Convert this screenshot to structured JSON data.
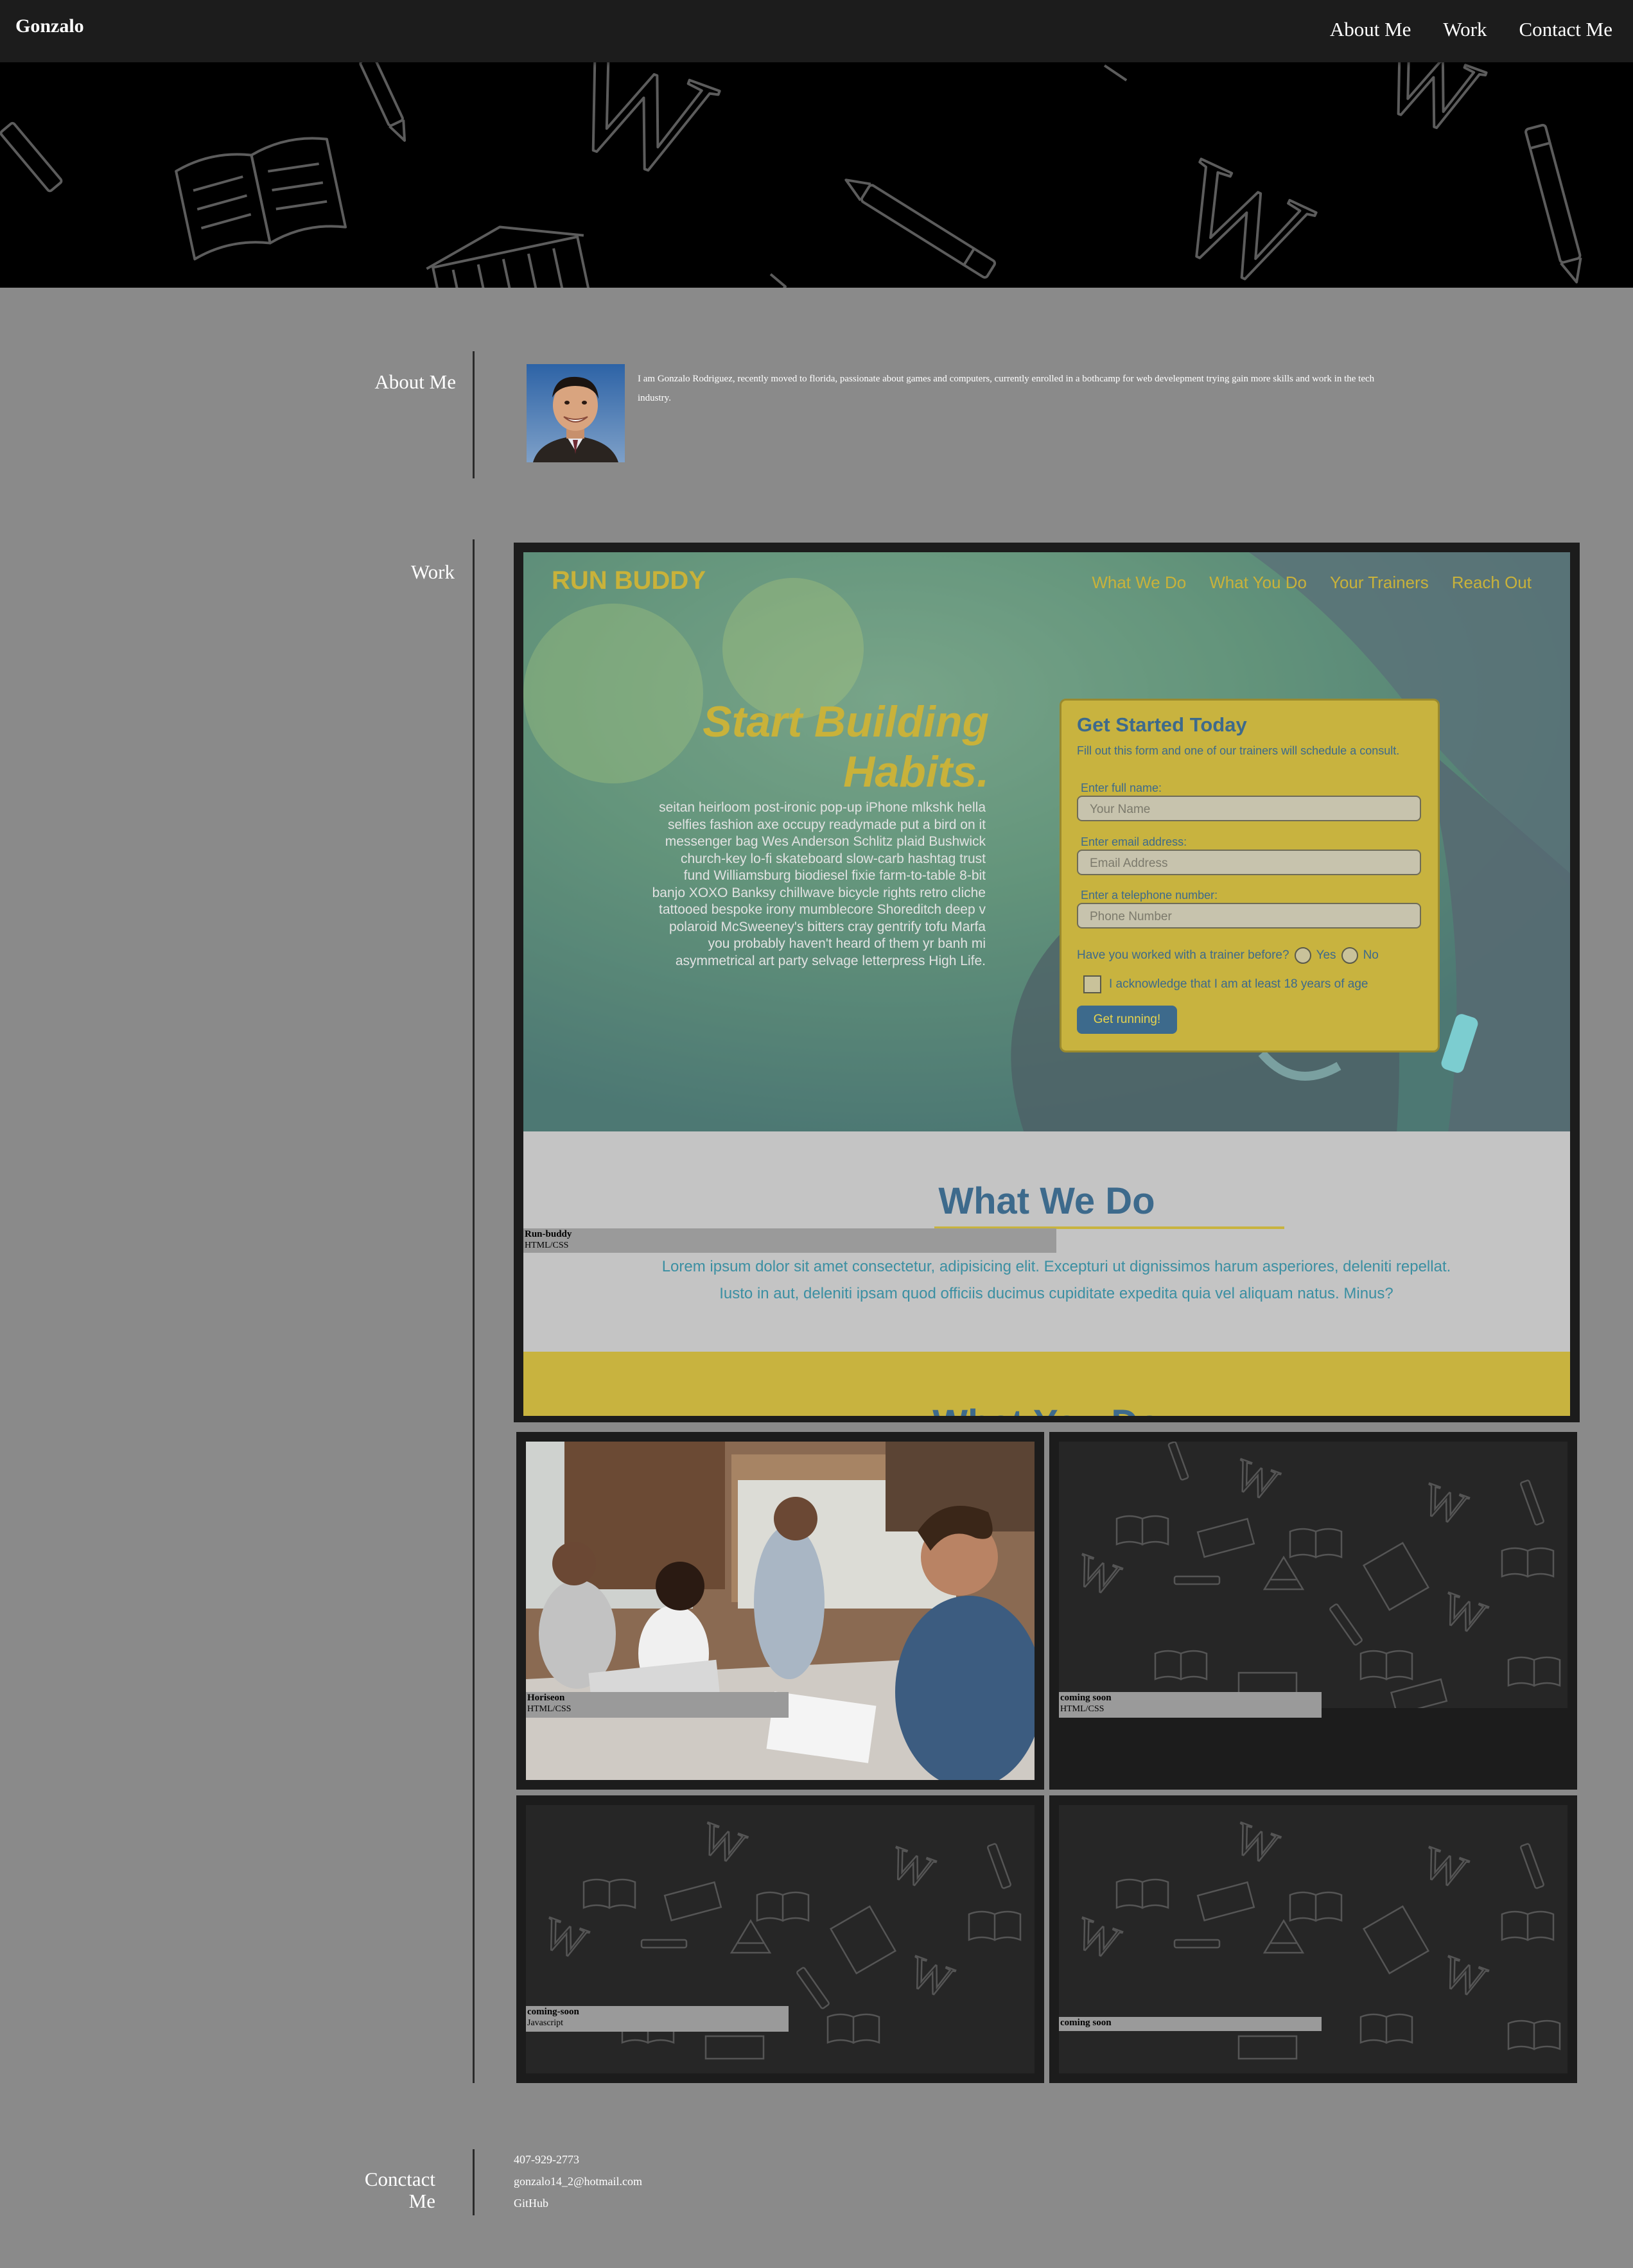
{
  "header": {
    "brand": "Gonzalo",
    "nav": [
      "About Me",
      "Work",
      "Contact Me"
    ]
  },
  "about": {
    "label": "About Me",
    "bio": "I am Gonzalo Rodriguez, recently moved to florida, passionate about games and computers, currently enrolled in a bothcamp for web develepment trying gain more skills and work in the tech industry."
  },
  "work": {
    "label": "Work",
    "featured": {
      "title": "Run-buddy",
      "tech": "HTML/CSS",
      "preview": {
        "site_title": "RUN BUDDY",
        "nav": [
          "What We Do",
          "What You Do",
          "Your Trainers",
          "Reach Out"
        ],
        "headline": "Start Building Habits.",
        "copy": "seitan heirloom post-ironic pop-up iPhone mlkshk hella selfies fashion axe occupy readymade put a bird on it messenger bag Wes Anderson Schlitz plaid Bushwick church-key lo-fi skateboard slow-carb hashtag trust fund Williamsburg biodiesel fixie farm-to-table 8-bit banjo XOXO Banksy chillwave bicycle rights retro cliche tattooed bespoke irony mumblecore Shoreditch deep v polaroid McSweeney's bitters cray gentrify tofu Marfa you probably haven't heard of them yr banh mi asymmetrical art party selvage letterpress High Life.",
        "form": {
          "title": "Get Started Today",
          "subtitle": "Fill out this form and one of our trainers will schedule a consult.",
          "name_label": "Enter full name:",
          "name_placeholder": "Your Name",
          "email_label": "Enter email address:",
          "email_placeholder": "Email Address",
          "phone_label": "Enter a telephone number:",
          "phone_placeholder": "Phone Number",
          "question": "Have you worked with a trainer before?",
          "yes": "Yes",
          "no": "No",
          "ack": "I acknowledge that I am at least 18 years of age",
          "button": "Get running!"
        },
        "section_title": "What We Do",
        "section_text": "Lorem ipsum dolor sit amet consectetur, adipisicing elit. Excepturi ut dignissimos harum asperiores, deleniti repellat. Iusto in aut, deleniti ipsam quod officiis ducimus cupiditate expedita quia vel aliquam natus. Minus?",
        "next_title": "What You Do"
      }
    },
    "projects": [
      {
        "title": "Horiseon",
        "tech": "HTML/CSS"
      },
      {
        "title": "coming soon",
        "tech": "HTML/CSS"
      },
      {
        "title": "coming-soon",
        "tech": "Javascript"
      },
      {
        "title": "coming soon",
        "tech": ""
      }
    ]
  },
  "contact": {
    "label": "Conctact Me",
    "phone": "407-929-2773",
    "email": "gonzalo14_2@hotmail.com",
    "github": "GitHub"
  },
  "colors": {
    "page_bg": "#8a8a8a",
    "nav_bg": "#1c1c1c",
    "runbuddy_yellow": "#c8b33f",
    "runbuddy_blue": "#3d6a8c"
  }
}
